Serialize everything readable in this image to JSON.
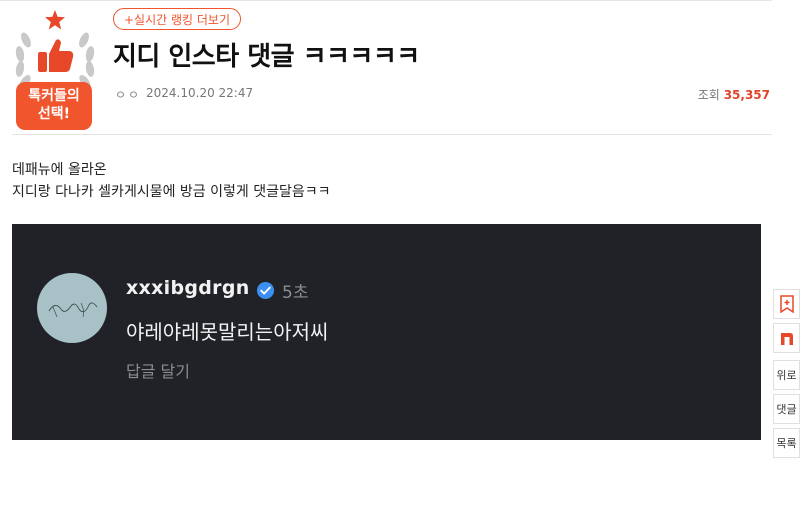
{
  "badge": {
    "line1": "톡커들의",
    "line2": "선택!"
  },
  "ranking": {
    "label": "+실시간 랭킹 더보기"
  },
  "post": {
    "title": "지디 인스타 댓글 ㅋㅋㅋㅋㅋ",
    "author": "ㅇㅇ",
    "date": "2024.10.20 22:47",
    "views_label": "조회",
    "views_count": "35,357",
    "body_lines": [
      "데패뉴에 올라온",
      "지디랑 다나카 셀카게시물에 방금 이렇게 댓글달음ㅋㅋ"
    ]
  },
  "comment": {
    "username": "xxxibgdrgn",
    "time": "5초",
    "text": "야레야레못말리는아저씨",
    "reply": "답글 달기"
  },
  "side": {
    "up": "위로",
    "comments": "댓글",
    "list": "목록"
  },
  "colors": {
    "accent": "#f0552e",
    "views": "#e0442a",
    "embed_bg": "#202228"
  }
}
